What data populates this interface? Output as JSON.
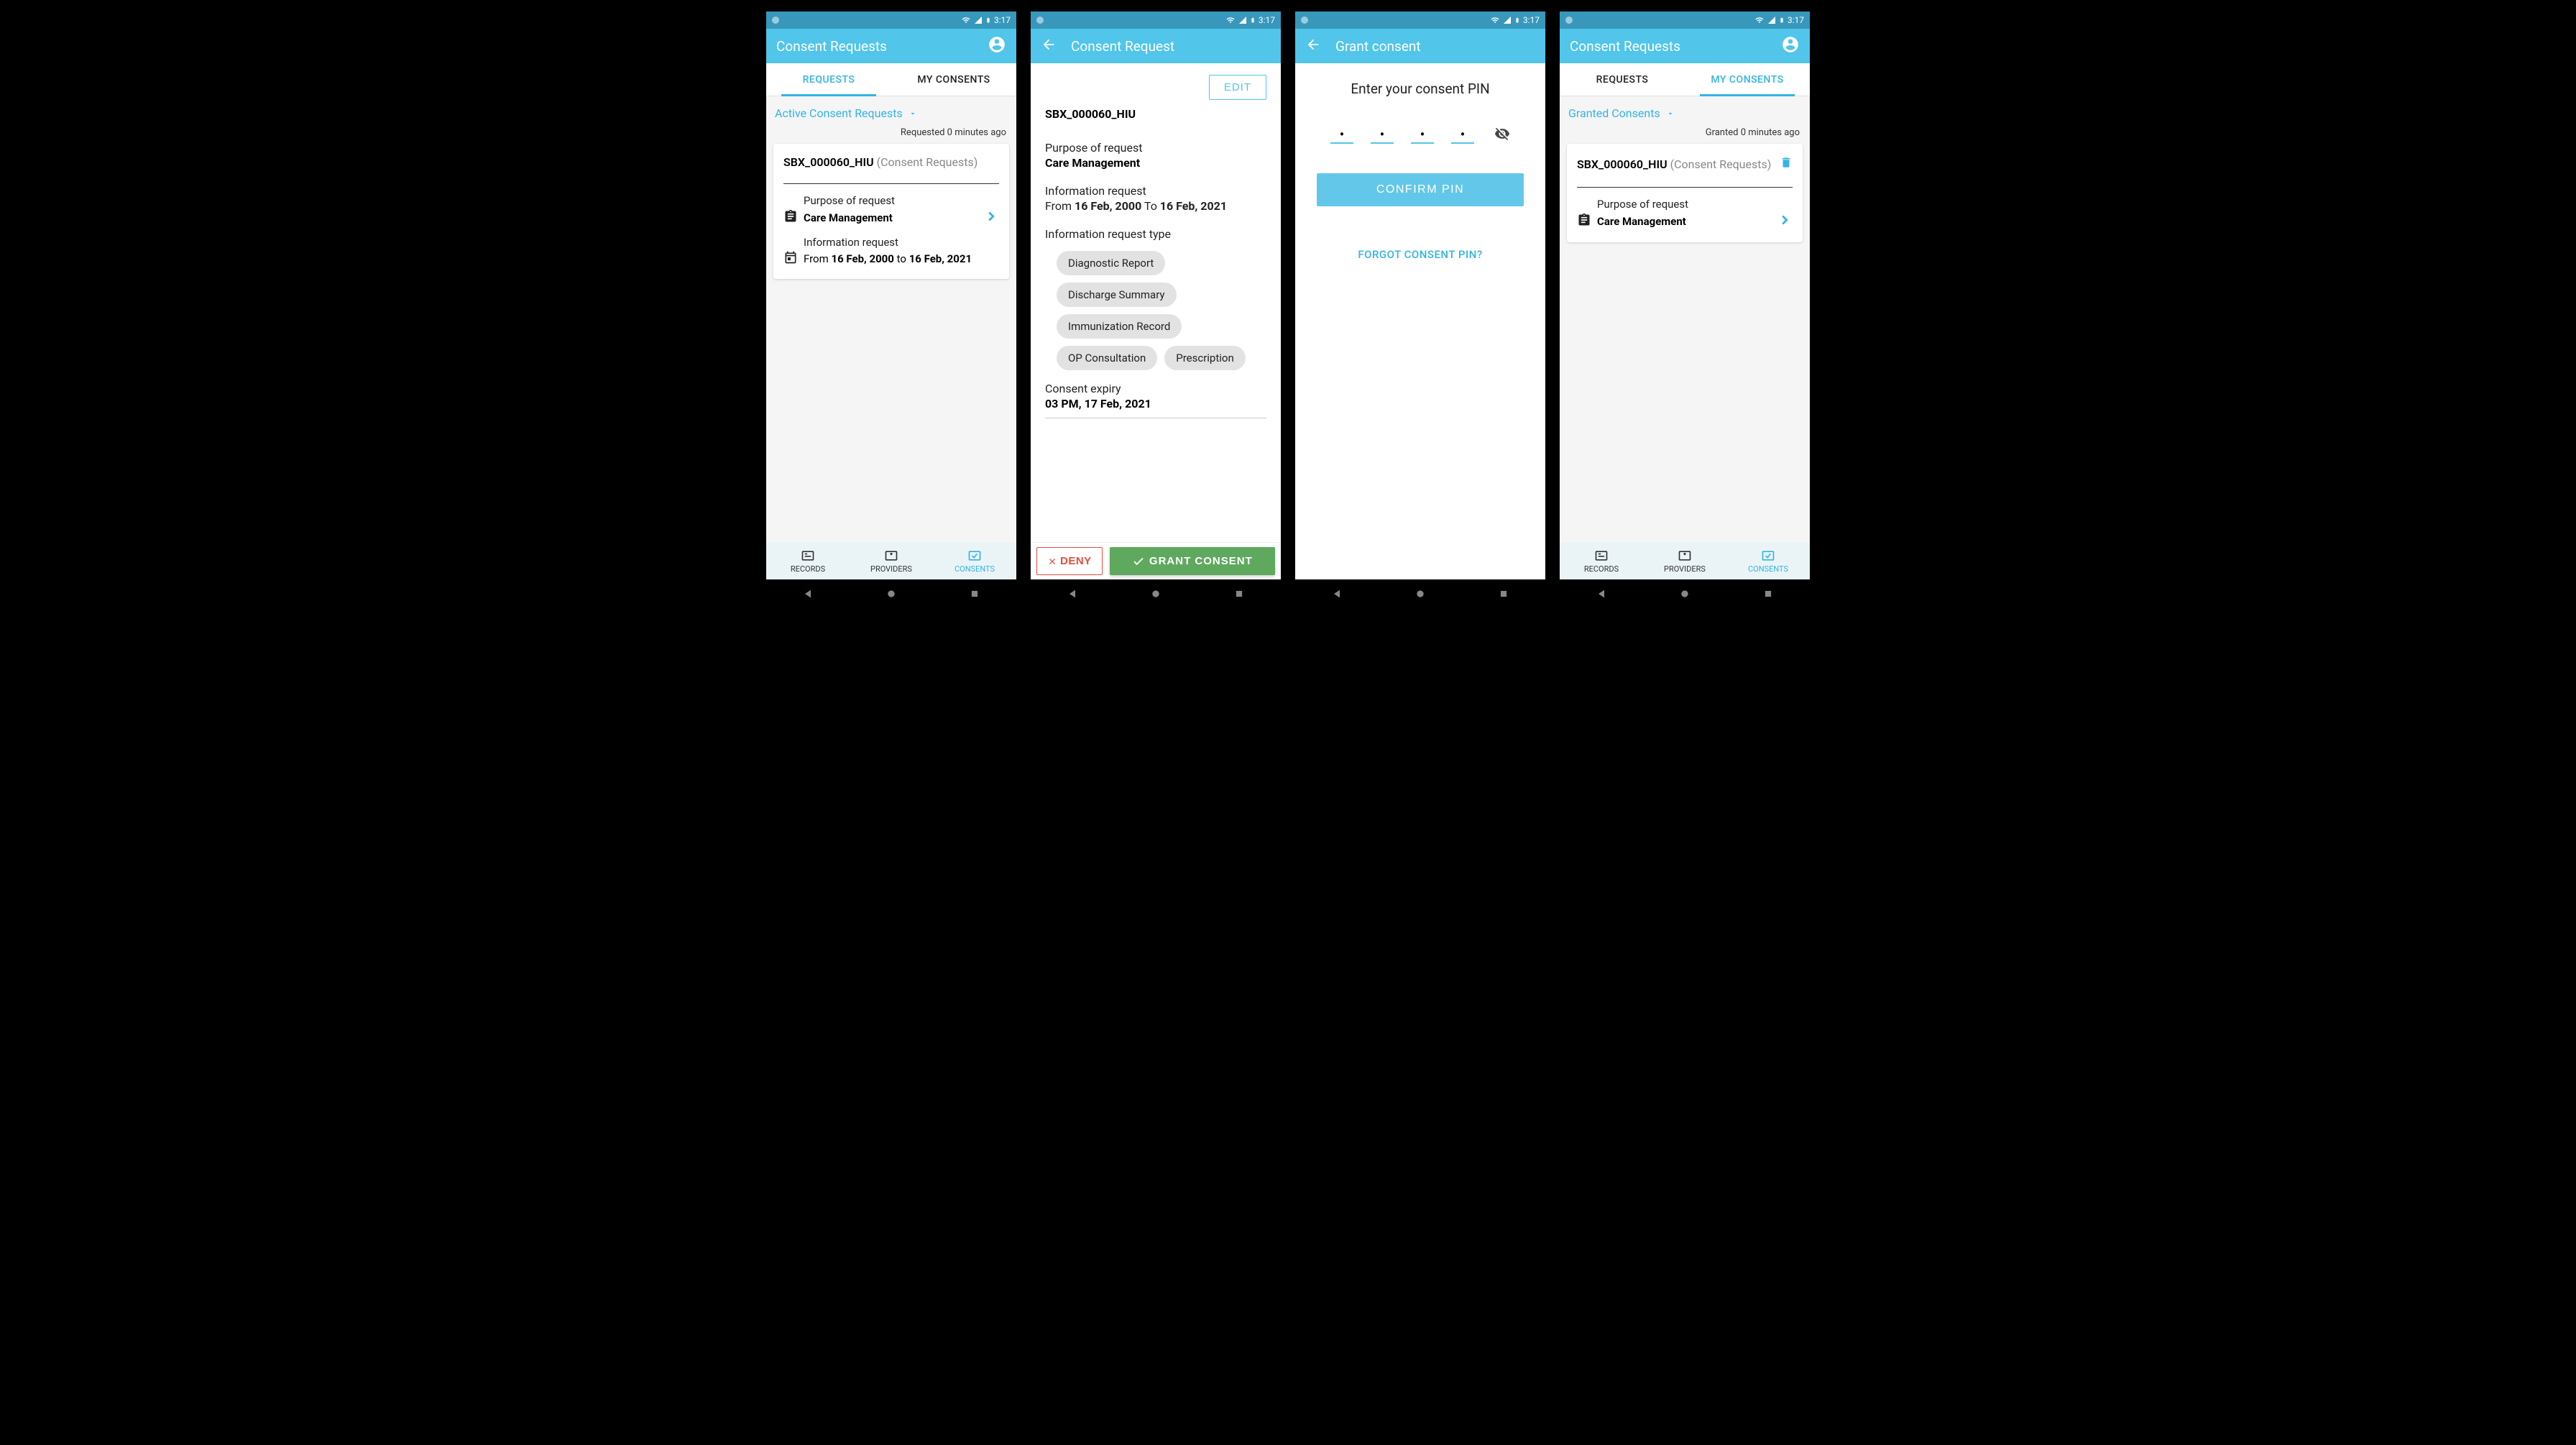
{
  "status": {
    "time": "3:17"
  },
  "screen1": {
    "title": "Consent Requests",
    "tabs": {
      "requests": "REQUESTS",
      "myconsents": "MY CONSENTS"
    },
    "dropdown": "Active Consent Requests",
    "timestamp": "Requested 0 minutes ago",
    "card": {
      "title": "SBX_000060_HIU",
      "subtitle": "(Consent Requests)",
      "purpose_label": "Purpose of request",
      "purpose_value": "Care Management",
      "info_label": "Information request",
      "from_word": "From",
      "from_date": "16 Feb, 2000",
      "to_word": "to",
      "to_date": "16 Feb, 2021"
    },
    "nav": {
      "records": "RECORDS",
      "providers": "PROVIDERS",
      "consents": "CONSENTS"
    }
  },
  "screen2": {
    "title": "Consent Request",
    "edit": "EDIT",
    "id": "SBX_000060_HIU",
    "purpose_label": "Purpose of request",
    "purpose_value": "Care Management",
    "info_label": "Information request",
    "from_word": "From",
    "from_date": "16 Feb, 2000",
    "to_word": "To",
    "to_date": "16 Feb, 2021",
    "type_label": "Information request type",
    "chips": [
      "Diagnostic Report",
      "Discharge Summary",
      "Immunization Record",
      "OP Consultation",
      "Prescription"
    ],
    "expiry_label": "Consent expiry",
    "expiry_value": "03 PM, 17 Feb, 2021",
    "deny": "DENY",
    "grant": "GRANT CONSENT"
  },
  "screen3": {
    "title": "Grant consent",
    "heading": "Enter your consent PIN",
    "confirm": "CONFIRM PIN",
    "forgot": "FORGOT CONSENT PIN?"
  },
  "screen4": {
    "title": "Consent Requests",
    "tabs": {
      "requests": "REQUESTS",
      "myconsents": "MY CONSENTS"
    },
    "dropdown": "Granted Consents",
    "timestamp": "Granted 0 minutes ago",
    "card": {
      "title": "SBX_000060_HIU",
      "subtitle": "(Consent Requests)",
      "purpose_label": "Purpose of request",
      "purpose_value": "Care Management"
    },
    "nav": {
      "records": "RECORDS",
      "providers": "PROVIDERS",
      "consents": "CONSENTS"
    }
  }
}
